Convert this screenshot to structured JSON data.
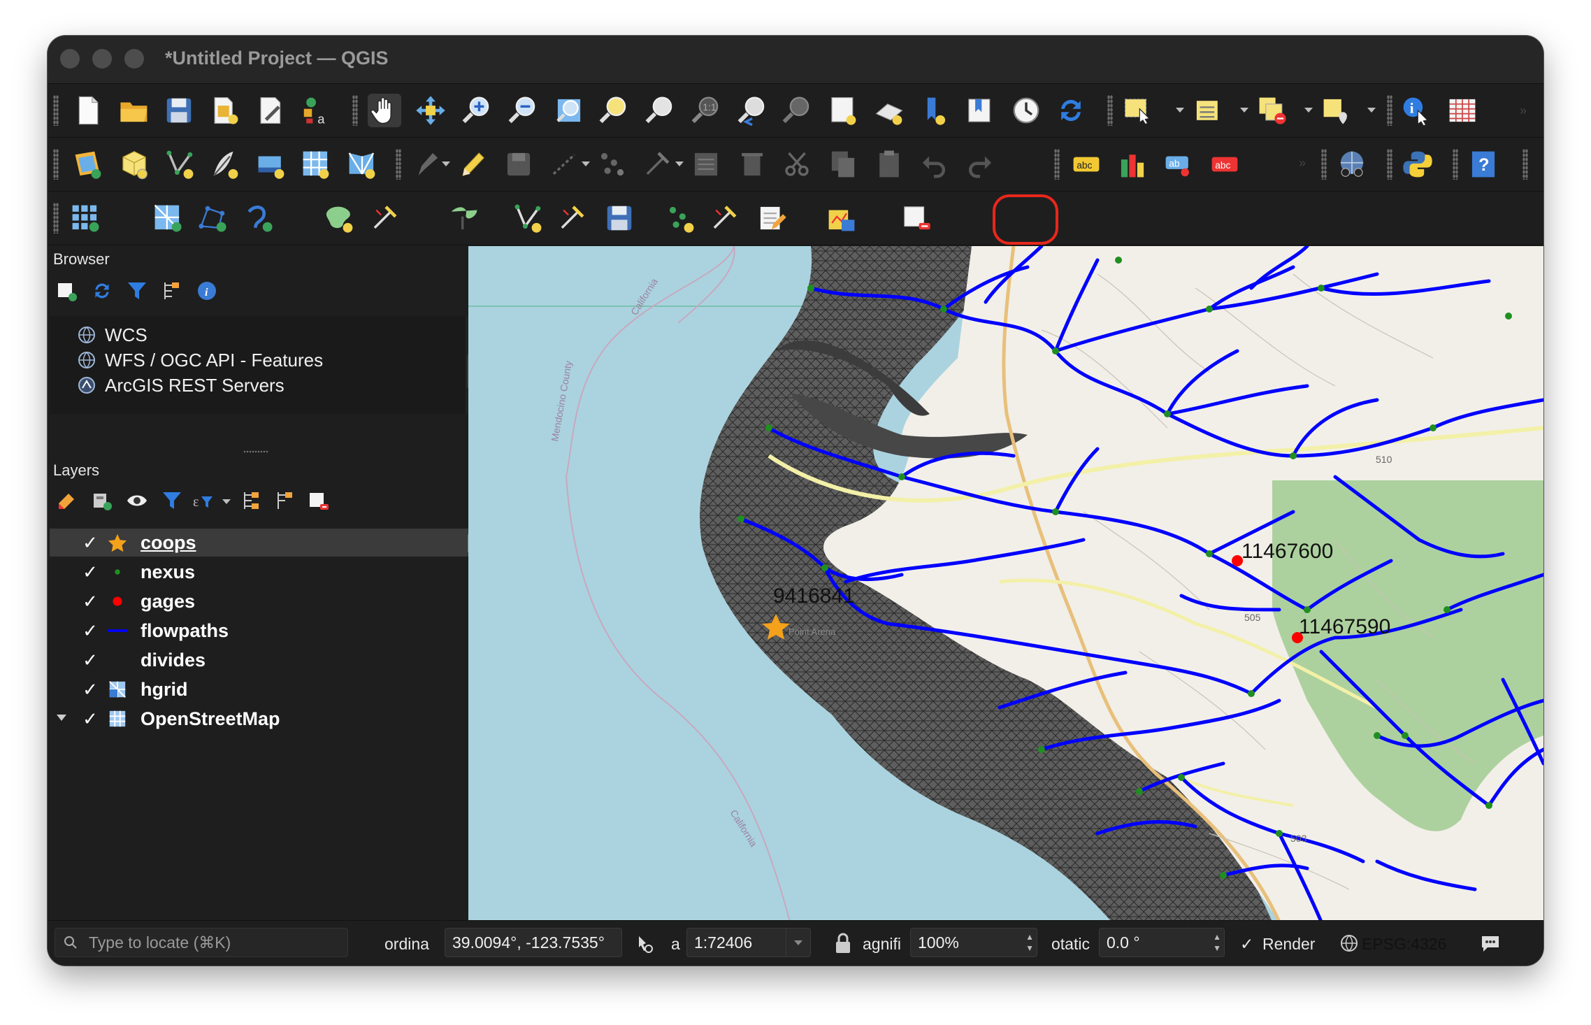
{
  "window": {
    "title": "*Untitled Project — QGIS"
  },
  "browser": {
    "title": "Browser",
    "items": [
      {
        "label": "WCS",
        "icon": "globe-icon"
      },
      {
        "label": "WFS / OGC API - Features",
        "icon": "globe-icon"
      },
      {
        "label": "ArcGIS REST Servers",
        "icon": "arcgis-icon"
      }
    ]
  },
  "layers": {
    "title": "Layers",
    "items": [
      {
        "name": "coops",
        "checked": true,
        "symbol": "star",
        "selected": true
      },
      {
        "name": "nexus",
        "checked": true,
        "symbol": "green-dot"
      },
      {
        "name": "gages",
        "checked": true,
        "symbol": "red-dot"
      },
      {
        "name": "flowpaths",
        "checked": true,
        "symbol": "blue-line"
      },
      {
        "name": "divides",
        "checked": true,
        "symbol": "none"
      },
      {
        "name": "hgrid",
        "checked": true,
        "symbol": "mesh"
      },
      {
        "name": "OpenStreetMap",
        "checked": true,
        "symbol": "raster",
        "expanded": true
      }
    ]
  },
  "map": {
    "labels": {
      "gage1": "11467600",
      "gage2": "11467590",
      "coop": "9416841",
      "road1": "510",
      "road2": "505",
      "road3": "503",
      "water1": "California",
      "water2": "Mendocino County",
      "water3": "California",
      "town": "Point Arena"
    },
    "colors": {
      "water": "#aad3df",
      "land": "#f2efe9",
      "forest": "#add19e",
      "flowpath": "#0000ff",
      "nexus": "#1f8f1f",
      "gage": "#ff0000",
      "coop": "#f4a11c"
    }
  },
  "status": {
    "locate_placeholder": "Type to locate (⌘K)",
    "coordinate_label": "ordina",
    "coordinate_value": "39.0094°, -123.7535°",
    "scale_label": "a",
    "scale_value": "1:72406",
    "magnifier_label": "agnifi",
    "magnifier_value": "100%",
    "rotation_label": "otatic",
    "rotation_value": "0.0 °",
    "render_label": "Render",
    "render_checked": "✓",
    "crs": "EPSG:4326"
  }
}
